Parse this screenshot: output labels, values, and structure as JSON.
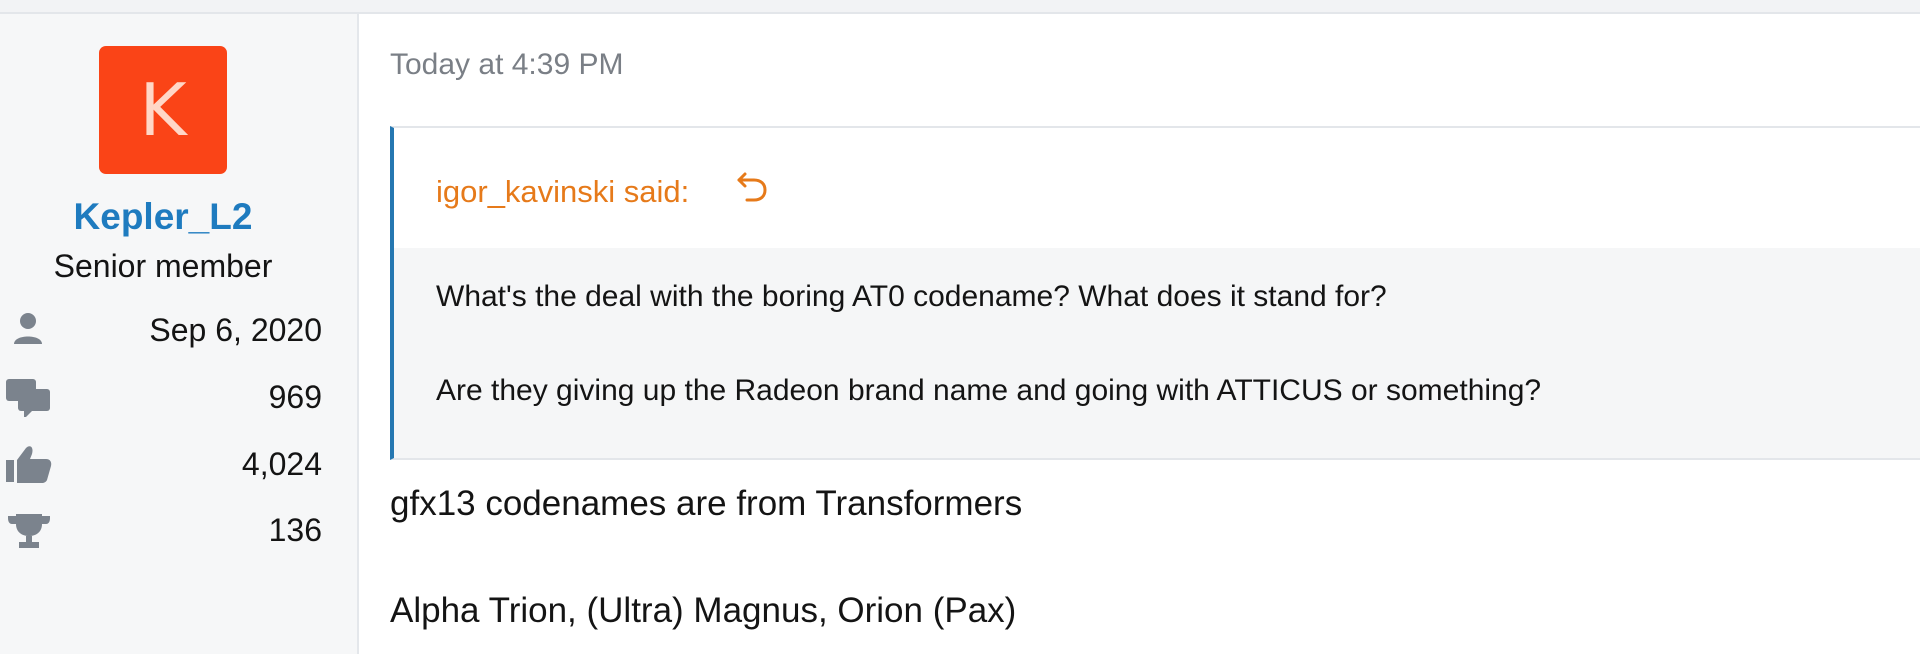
{
  "post": {
    "date": "Today at 4:39 PM",
    "user": {
      "avatar_letter": "K",
      "avatar_color": "#fa4417",
      "username": "Kepler_L2",
      "username_color": "#1e7bbf",
      "title": "Senior member",
      "stats": [
        {
          "icon": "user-icon",
          "value": "Sep 6, 2020"
        },
        {
          "icon": "messages-icon",
          "value": "969"
        },
        {
          "icon": "thumbs-up-icon",
          "value": "4,024"
        },
        {
          "icon": "trophy-icon",
          "value": "136"
        }
      ]
    },
    "quote": {
      "author_line": "igor_kavinski said:",
      "jump_icon": "reply-arrow-icon",
      "lines": [
        "What's the deal with the boring AT0 codename? What does it stand for?",
        "Are they giving up the Radeon brand name and going with ATTICUS or something?"
      ]
    },
    "body": [
      "gfx13 codenames are from Transformers",
      "Alpha Trion, (Ultra) Magnus, Orion (Pax)"
    ]
  }
}
